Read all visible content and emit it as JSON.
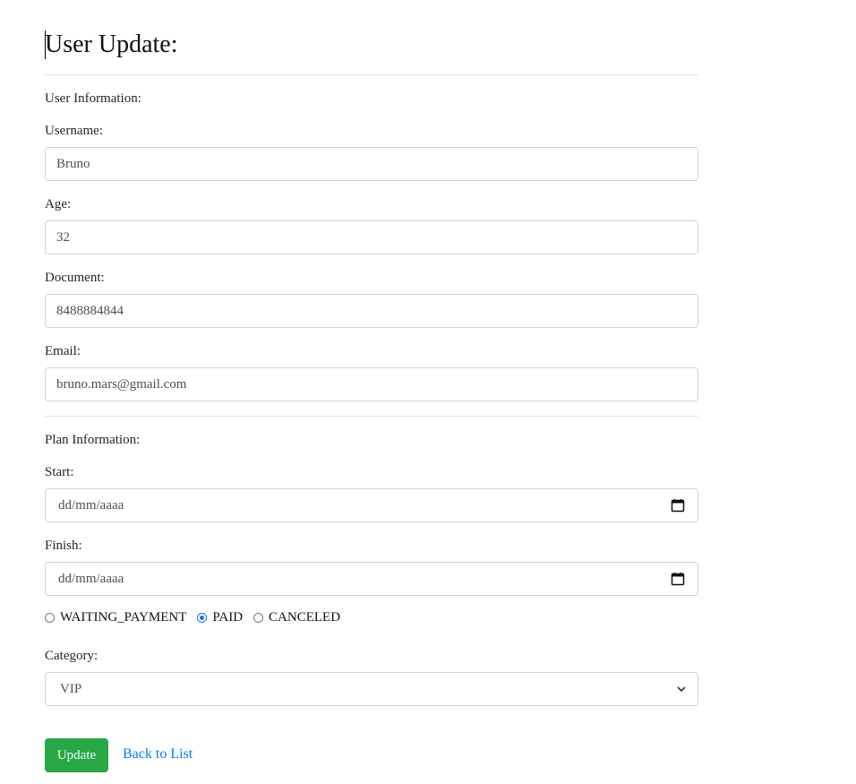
{
  "page": {
    "title": "User Update:"
  },
  "user_section": {
    "title": "User Information:",
    "username": {
      "label": "Username:",
      "value": "Bruno"
    },
    "age": {
      "label": "Age:",
      "value": "32"
    },
    "document": {
      "label": "Document:",
      "value": "8488884844"
    },
    "email": {
      "label": "Email:",
      "value": "bruno.mars@gmail.com"
    }
  },
  "plan_section": {
    "title": "Plan Information:",
    "start": {
      "label": "Start:",
      "placeholder": "dd/mm/aaaa"
    },
    "finish": {
      "label": "Finish:",
      "placeholder": "dd/mm/aaaa"
    },
    "status": {
      "options": [
        "WAITING_PAYMENT",
        "PAID",
        "CANCELED"
      ],
      "selected": "PAID"
    },
    "category": {
      "label": "Category:",
      "selected": "VIP"
    }
  },
  "actions": {
    "update_label": "Update",
    "back_label": "Back to List"
  },
  "colors": {
    "primary_button": "#28a745",
    "link": "#007bff",
    "radio_checked": "#1a73e8"
  }
}
